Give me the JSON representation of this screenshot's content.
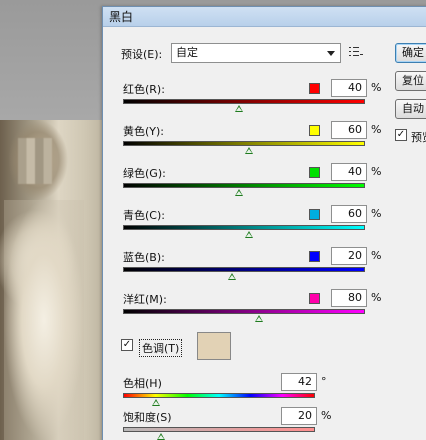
{
  "dialog": {
    "title": "黑白",
    "preset_label": "预设(E):",
    "preset_value": "自定"
  },
  "channels": [
    {
      "label": "红色(R):",
      "color": "#ff0000",
      "value": "40",
      "unit": "%",
      "track": "linear-gradient(90deg,#000,#ff0000)",
      "thumb": 0.48
    },
    {
      "label": "黄色(Y):",
      "color": "#ffff00",
      "value": "60",
      "unit": "%",
      "track": "linear-gradient(90deg,#000,#ffff00)",
      "thumb": 0.52
    },
    {
      "label": "绿色(G):",
      "color": "#00e000",
      "value": "40",
      "unit": "%",
      "track": "linear-gradient(90deg,#000,#00ff00)",
      "thumb": 0.48
    },
    {
      "label": "青色(C):",
      "color": "#00aee0",
      "value": "60",
      "unit": "%",
      "track": "linear-gradient(90deg,#000,#00ffff)",
      "thumb": 0.52
    },
    {
      "label": "蓝色(B):",
      "color": "#0000ff",
      "value": "20",
      "unit": "%",
      "track": "linear-gradient(90deg,#000,#0000ff)",
      "thumb": 0.45
    },
    {
      "label": "洋红(M):",
      "color": "#ff00aa",
      "value": "80",
      "unit": "%",
      "track": "linear-gradient(90deg,#000,#ff00ff)",
      "thumb": 0.56
    }
  ],
  "tint": {
    "checked": true,
    "label": "色调(T)",
    "color": "#e2d2b5"
  },
  "hue": {
    "label": "色相(H)",
    "value": "42",
    "unit": "°",
    "thumb": 0.17
  },
  "saturation": {
    "label": "饱和度(S)",
    "value": "20",
    "unit": "%",
    "thumb": 0.2
  },
  "side_buttons": [
    {
      "label": "确定",
      "name": "ok-button",
      "default": true
    },
    {
      "label": "复位",
      "name": "reset-button",
      "default": false
    },
    {
      "label": "自动",
      "name": "auto-button",
      "default": false
    }
  ],
  "preview": {
    "label": "预览",
    "checked": true
  }
}
